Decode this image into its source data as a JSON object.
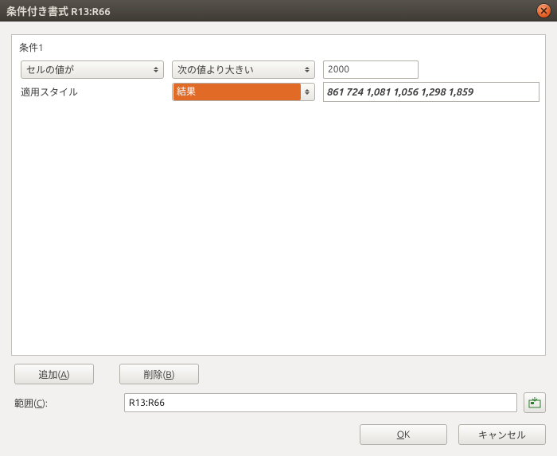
{
  "window": {
    "title": "条件付き書式 R13:R66"
  },
  "condition": {
    "group_label": "条件1",
    "mode": "セルの値が",
    "operator": "次の値より大きい",
    "value": "2000",
    "apply_style_label": "適用スタイル",
    "style": "結果",
    "preview": "861  724 1,081 1,056 1,298 1,859"
  },
  "buttons": {
    "add": "追加(A)",
    "delete": "削除(B)",
    "ok": "OK",
    "cancel": "キャンセル"
  },
  "range": {
    "label": "範囲(C):",
    "value": "R13:R66"
  }
}
